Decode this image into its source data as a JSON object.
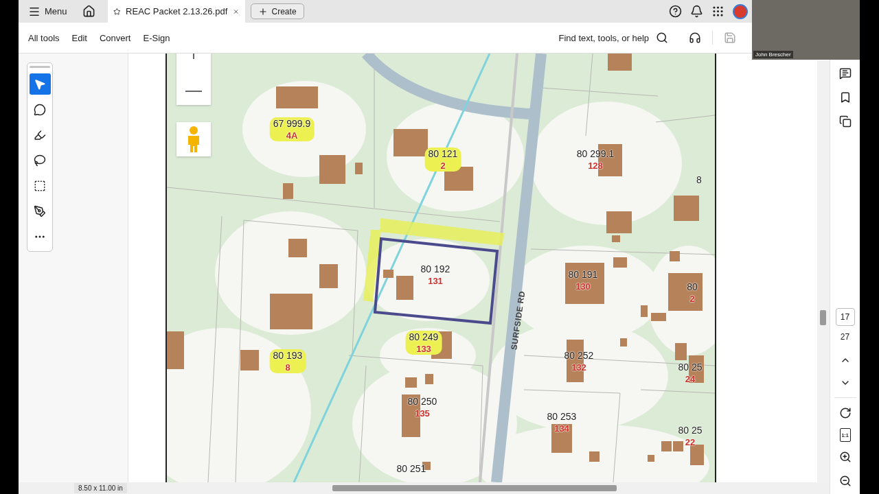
{
  "tab_bar": {
    "menu_label": "Menu",
    "document_tab": {
      "title": "REAC Packet 2.13.26.pdf",
      "selected": true
    },
    "create_label": "Create"
  },
  "toolbar": {
    "items": [
      "All tools",
      "Edit",
      "Convert",
      "E-Sign"
    ],
    "search_label": "Find text, tools, or help"
  },
  "tool_palette": [
    {
      "selected": true
    },
    {
      "selected": false
    },
    {
      "selected": false
    },
    {
      "selected": false
    },
    {
      "selected": false
    },
    {
      "selected": false
    }
  ],
  "map": {
    "road_label": "SURFSIDE RD",
    "parcels": [
      {
        "number": "67 999.9",
        "lot": "4A",
        "highlighted": true
      },
      {
        "number": "80 121",
        "lot": "2",
        "highlighted": true
      },
      {
        "number": "80 299.1",
        "lot": "128",
        "highlighted": false
      },
      {
        "number": "8",
        "highlighted": false
      },
      {
        "number": "80 192",
        "lot": "131",
        "highlighted": false
      },
      {
        "number": "80 191",
        "lot": "130",
        "highlighted": false
      },
      {
        "number": "80",
        "lot": "2",
        "highlighted": false
      },
      {
        "number": "80 249",
        "lot": "133",
        "highlighted": true
      },
      {
        "number": "80 193",
        "lot": "8",
        "highlighted": true
      },
      {
        "number": "80 252",
        "lot": "132",
        "highlighted": false
      },
      {
        "number": "80 25",
        "lot": "24",
        "highlighted": false
      },
      {
        "number": "80 250",
        "lot": "135",
        "highlighted": false
      },
      {
        "number": "80 253",
        "lot": "134",
        "highlighted": false
      },
      {
        "number": "80 25",
        "lot": "22",
        "highlighted": false
      },
      {
        "number": "80 251",
        "highlighted": false
      }
    ]
  },
  "page_nav": {
    "current_page": "17",
    "total_pages": "27",
    "fit_label": "1:1"
  },
  "status_bar": {
    "page_size": "8.50 x 11.00 in"
  },
  "video": {
    "participant_name": "John Brescher"
  }
}
